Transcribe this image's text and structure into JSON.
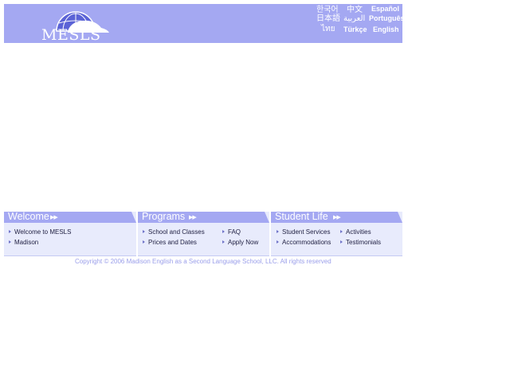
{
  "header": {
    "logo_text": "MESLS",
    "languages": [
      {
        "label": "한국어"
      },
      {
        "label": "中文"
      },
      {
        "label": "Español"
      },
      {
        "label": "日本語"
      },
      {
        "label": "العربية"
      },
      {
        "label": "Português"
      },
      {
        "label": "ไทย"
      },
      {
        "label": "Türkçe"
      },
      {
        "label": "English"
      }
    ]
  },
  "nav": {
    "welcome": {
      "title": "Welcome",
      "items": [
        "Welcome to MESLS",
        "Madison"
      ]
    },
    "programs": {
      "title": "Programs",
      "items": [
        "School and Classes",
        "Prices and Dates",
        "FAQ",
        "Apply Now"
      ]
    },
    "student_life": {
      "title": "Student Life",
      "items": [
        "Student Services",
        "Accommodations",
        "Activities",
        "Testimonials"
      ]
    }
  },
  "footer": {
    "copyright": "Copyright © 2006 Madison English as a Second Language School, LLC. All rights reserved"
  },
  "colors": {
    "accent": "#a4a8f2",
    "panel": "#e8ebfc",
    "link": "#9a9eea"
  }
}
